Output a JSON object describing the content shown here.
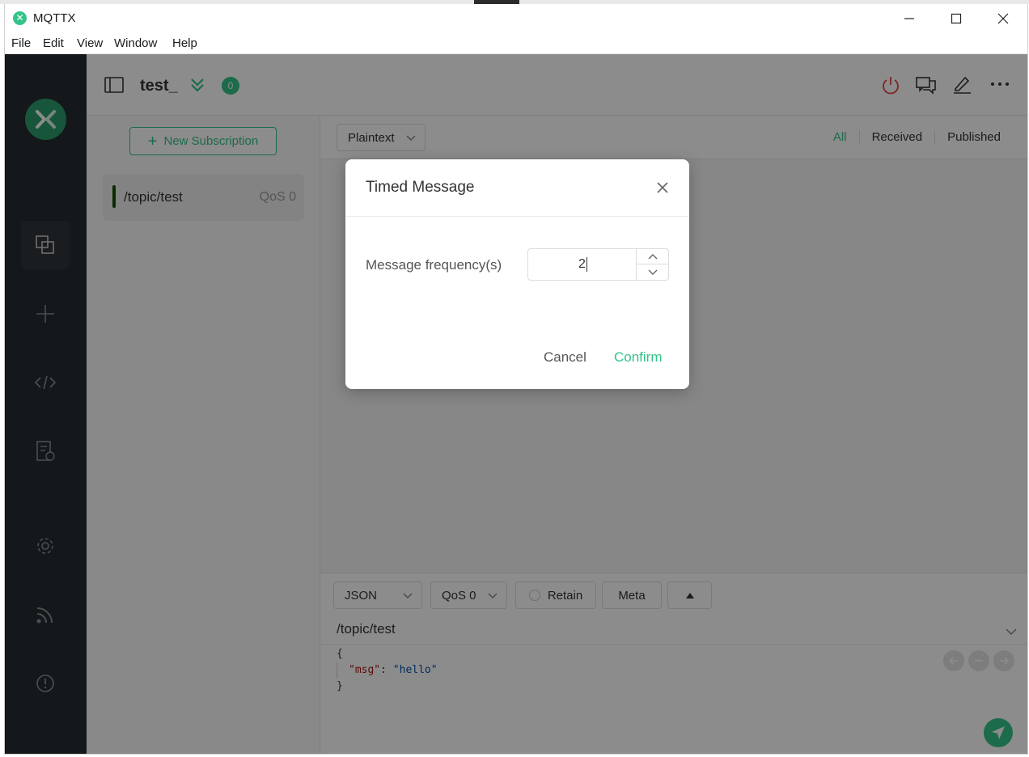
{
  "window": {
    "title": "MQTTX"
  },
  "menu": {
    "file": "File",
    "edit": "Edit",
    "view": "View",
    "window": "Window",
    "help": "Help"
  },
  "header": {
    "connection_name": "test_",
    "message_count": "0"
  },
  "subscriptions": {
    "new_label": "New Subscription",
    "items": [
      {
        "topic": "/topic/test",
        "qos": "QoS 0",
        "color": "#135200"
      }
    ]
  },
  "messages": {
    "format": "Plaintext",
    "filters": {
      "all": "All",
      "received": "Received",
      "published": "Published"
    }
  },
  "publish": {
    "payload_type": "JSON",
    "qos": "QoS 0",
    "retain_label": "Retain",
    "meta_label": "Meta",
    "topic": "/topic/test",
    "payload": {
      "open": "{",
      "key": "\"msg\"",
      "colon": ": ",
      "value": "\"hello\"",
      "close": "}"
    }
  },
  "dialog": {
    "title": "Timed Message",
    "field_label": "Message frequency(s)",
    "frequency_value": "2",
    "cancel_label": "Cancel",
    "confirm_label": "Confirm"
  },
  "colors": {
    "accent": "#34c388",
    "nav_bg": "#262c30",
    "disconnect": "#e34242"
  }
}
